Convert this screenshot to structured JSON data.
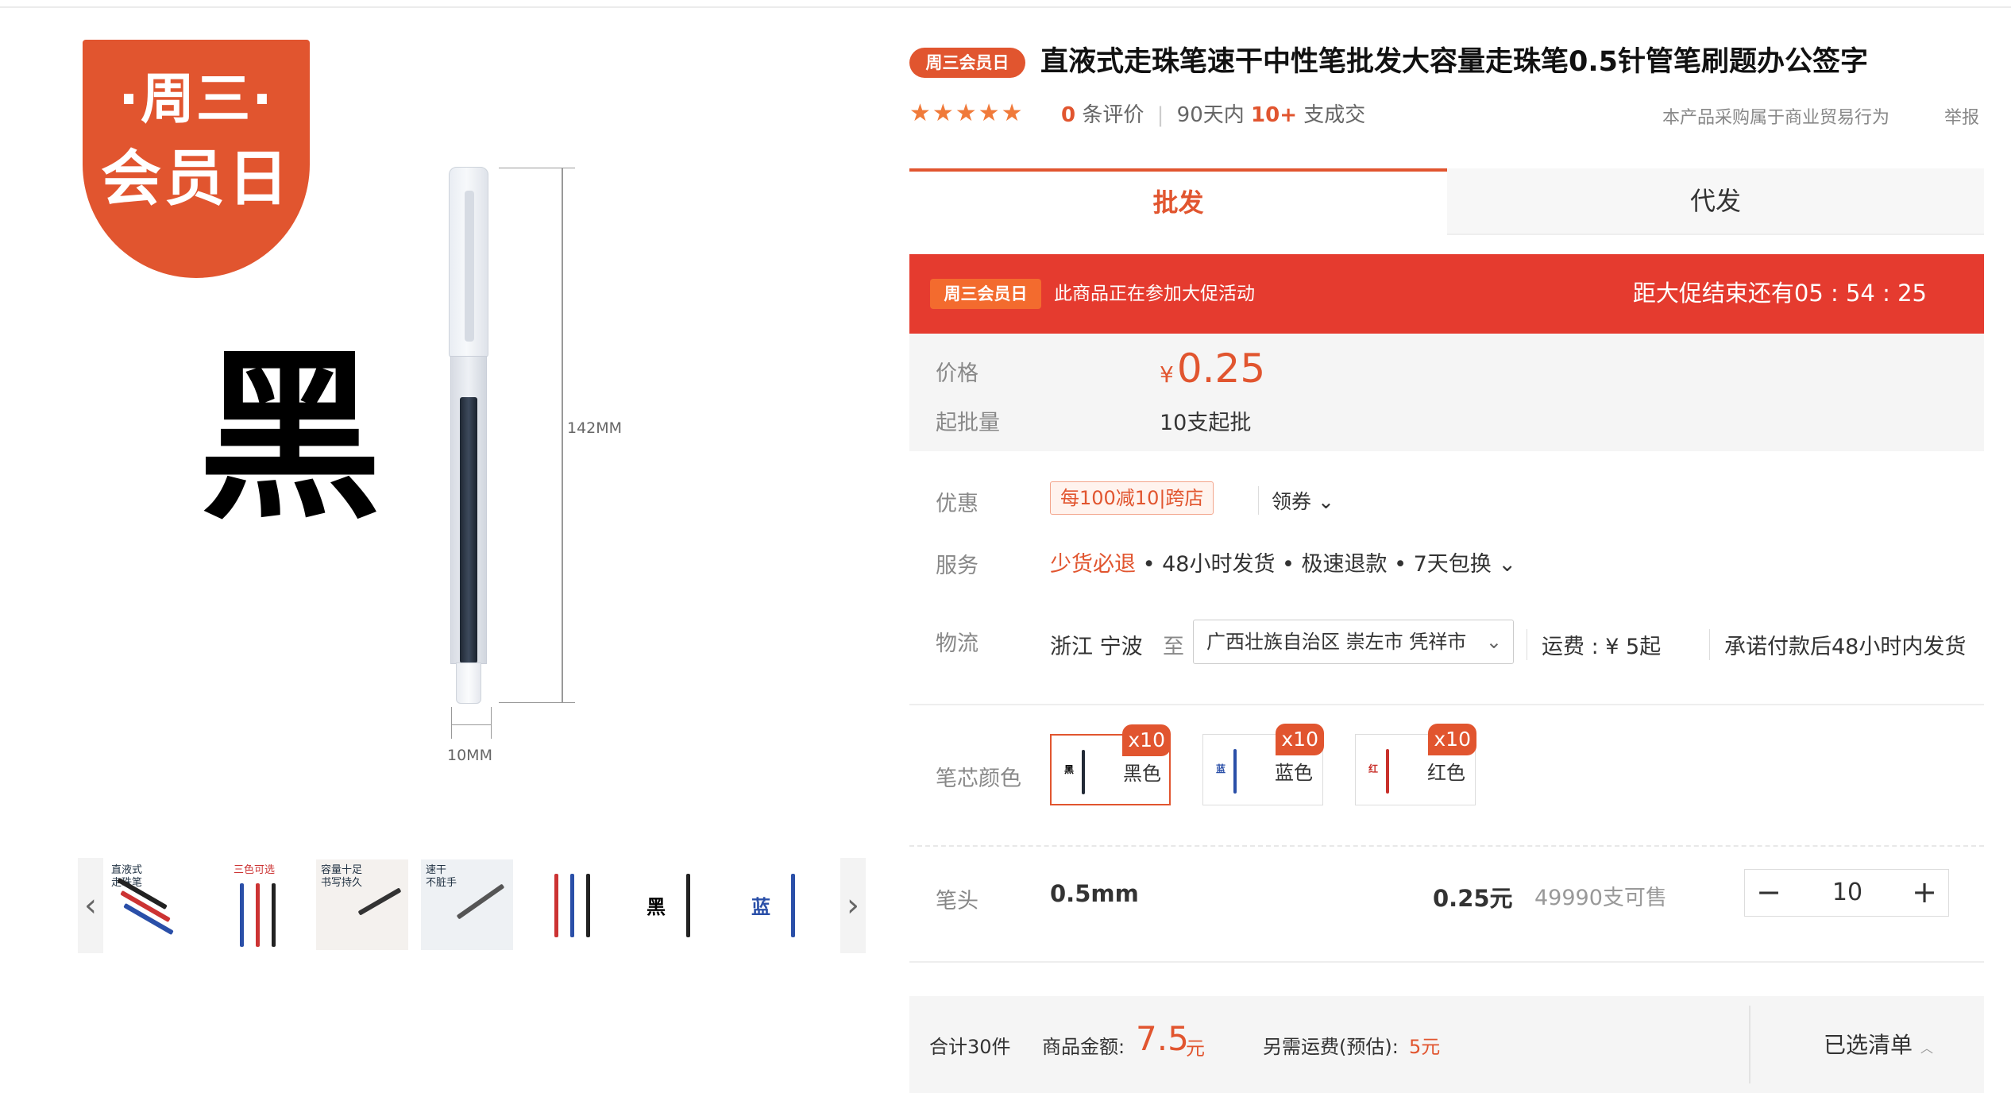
{
  "gallery": {
    "badge": {
      "line1": "·周三·",
      "line2": "会员日"
    },
    "main_char": "黑",
    "dim_length": "142MM",
    "dim_width": "10MM",
    "thumbs": [
      {
        "caption": "直液式\n走珠笔"
      },
      {
        "caption": "三色可选"
      },
      {
        "caption": "容量十足\n书写持久"
      },
      {
        "caption": "速干\n不脏手"
      },
      {
        "caption": ""
      },
      {
        "caption": "黑"
      },
      {
        "caption": "蓝"
      }
    ],
    "prev_icon": "chevron-left-icon",
    "next_icon": "chevron-right-icon"
  },
  "product": {
    "tag": "周三会员日",
    "title": "直液式走珠笔速干中性笔批发大容量走珠笔0.5针管笔刷题办公签字",
    "stars": "★★★★★",
    "review_count": "0",
    "review_label": "条评价",
    "sales_prefix": "90天内",
    "sales_count": "10+",
    "sales_suffix": "支成交",
    "biz_note": "本产品采购属于商业贸易行为",
    "report": "举报"
  },
  "tabs": {
    "wholesale": "批发",
    "dropship": "代发"
  },
  "promo": {
    "tag": "周三会员日",
    "text": "此商品正在参加大促活动",
    "countdown": "距大促结束还有05 : 54 : 25"
  },
  "price": {
    "label": "价格",
    "currency": "¥",
    "value": "0.25",
    "moq_label": "起批量",
    "moq": "10支起批"
  },
  "discount": {
    "label": "优惠",
    "coupon": "每100减10|跨店",
    "get_coupon": "领券 ⌄"
  },
  "service": {
    "label": "服务",
    "highlight": "少货必退",
    "rest": " • 48小时发货 • 极速退款 • 7天包换 ⌄"
  },
  "logistics": {
    "label": "物流",
    "origin": "浙江 宁波",
    "to": "至",
    "destination": "广西壮族自治区 崇左市 凭祥市",
    "freight": "运费 : ¥ 5起",
    "promise": "承诺付款后48小时内发货"
  },
  "colors": {
    "label": "笔芯颜色",
    "options": [
      {
        "char": "黑",
        "name": "黑色",
        "qty": "x10",
        "ink": "#222a36"
      },
      {
        "char": "蓝",
        "name": "蓝色",
        "qty": "x10",
        "ink": "#2a4fa8"
      },
      {
        "char": "红",
        "name": "红色",
        "qty": "x10",
        "ink": "#c8302a"
      }
    ]
  },
  "nib": {
    "label": "笔头",
    "value": "0.5mm",
    "unit_price": "0.25元",
    "stock": "49990支可售",
    "quantity": "10",
    "minus": "−",
    "plus": "+"
  },
  "footer": {
    "total": "合计30件",
    "amount_label": "商品金额:",
    "amount": "7.5",
    "amount_unit": "元",
    "shipping_label": "另需运费(预估):",
    "shipping": "5元",
    "cart": "已选清单",
    "cart_icon": "chevron-up-icon"
  },
  "colors_theme": {
    "accent": "#e1552f",
    "promo_bg": "#e53b2f"
  }
}
